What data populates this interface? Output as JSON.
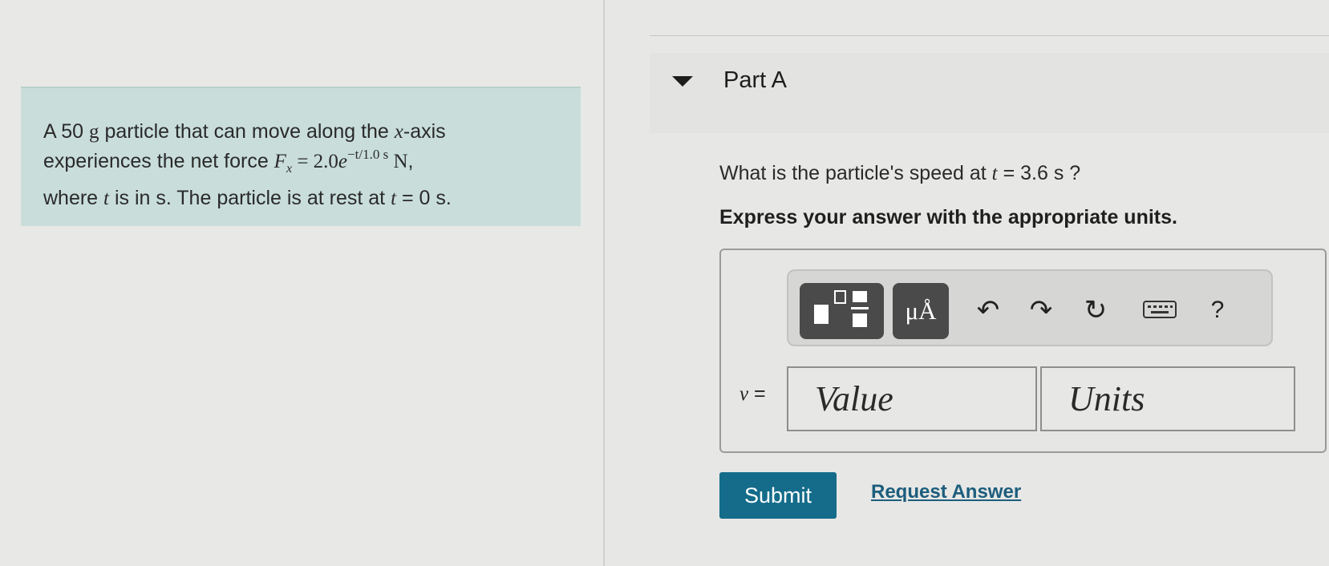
{
  "problem": {
    "line1_a": "A 50 ",
    "line1_unit": "g",
    "line1_b": " particle that can move along the ",
    "line1_var": "x",
    "line1_c": "-axis",
    "line2_a": "experiences the net force ",
    "line2_F": "F",
    "line2_sub": "x",
    "line2_eq": " = 2.0",
    "line2_e": "e",
    "line2_exp": "−t/1.0 s",
    "line2_unit": " N",
    "line2_end": ",",
    "line3_a": "where ",
    "line3_t": "t",
    "line3_b": " is in s. The particle is at rest at ",
    "line3_t2": "t",
    "line3_c": " = 0 s."
  },
  "part": {
    "title": "Part A"
  },
  "question": {
    "prefix": "What is the particle's speed at ",
    "var": "t",
    "suffix": " = 3.6 s ?"
  },
  "instruction": "Express your answer with the appropriate units.",
  "toolbar": {
    "units_label": "μÅ",
    "undo_icon": "↶",
    "redo_icon": "↷",
    "reset_icon": "↻",
    "help_label": "?"
  },
  "answer": {
    "variable": "v",
    "equals": " =",
    "value_placeholder": "Value",
    "units_placeholder": "Units"
  },
  "buttons": {
    "submit": "Submit",
    "request_answer": "Request Answer"
  },
  "colors": {
    "accent": "#146c8a",
    "problem_bg": "#c9dedb",
    "link": "#1c5d7d"
  }
}
